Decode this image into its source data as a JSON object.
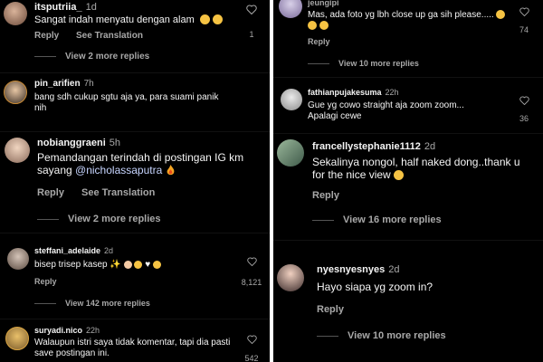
{
  "left": {
    "comments": [
      {
        "username": "itsputriia_",
        "time": "1d",
        "text": "Sangat indah menyatu dengan alam",
        "reply": "Reply",
        "translate": "See Translation",
        "likes": "1",
        "more_replies": "View 2 more replies"
      },
      {
        "username": "pin_arifien",
        "time": "7h",
        "text": "bang sdh cukup sgtu aja ya, para suami panik nih"
      },
      {
        "username": "nobianggraeni",
        "time": "5h",
        "text_before": "Pemandangan terindah di postingan IG km sayang ",
        "mention": "@nicholassaputra",
        "reply": "Reply",
        "translate": "See Translation",
        "more_replies": "View 2 more replies"
      },
      {
        "username": "steffani_adelaide",
        "time": "2d",
        "text": "bisep trisep kasep",
        "reply": "Reply",
        "likes": "8,121",
        "more_replies": "View 142 more replies"
      },
      {
        "username": "suryadi.nico",
        "time": "22h",
        "text": "Walaupun istri saya tidak komentar, tapi dia pasti save postingan ini.",
        "likes": "542"
      }
    ]
  },
  "right": {
    "comments": [
      {
        "username": "jeungipi",
        "text": "Mas, ada foto yg lbh close up ga sih please.....",
        "reply": "Reply",
        "likes": "74",
        "more_replies": "View 10 more replies"
      },
      {
        "username": "fathianpujakesuma",
        "time": "22h",
        "text": "Gue yg cowo straight aja zoom zoom... Apalagi cewe",
        "likes": "36"
      },
      {
        "username": "francellystephanie1112",
        "time": "2d",
        "text": "Sekalinya nongol, half naked dong..thank u for the nice view",
        "reply": "Reply",
        "more_replies": "View 16 more replies"
      },
      {
        "username": "nyesnyesnyes",
        "time": "2d",
        "text": "Hayo siapa yg zoom in?",
        "reply": "Reply",
        "more_replies": "View 10 more replies"
      }
    ]
  },
  "colors": {
    "background": "#000000",
    "primary_text": "#f5f5f5",
    "secondary_text": "#a8a8a8",
    "mention": "#c7d5ff",
    "divider": "#ffffff"
  },
  "icons": [
    "heart-icon",
    "avatar"
  ]
}
